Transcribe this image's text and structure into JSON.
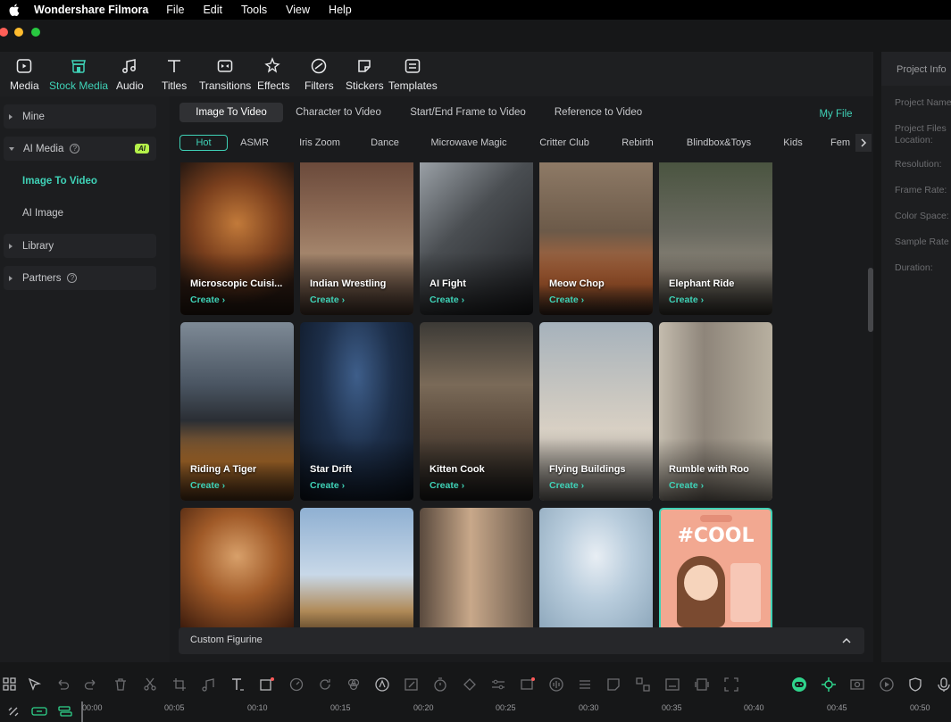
{
  "menubar": {
    "app_name": "Wondershare Filmora",
    "items": [
      "File",
      "Edit",
      "Tools",
      "View",
      "Help"
    ]
  },
  "window": {
    "traffic_colors": [
      "#ff5f57",
      "#febc2e",
      "#28c840"
    ]
  },
  "toolbar": {
    "accent": "#3fd2b7",
    "items": [
      {
        "label": "Media",
        "icon": "media-icon"
      },
      {
        "label": "Stock Media",
        "icon": "stock-media-icon",
        "active": true
      },
      {
        "label": "Audio",
        "icon": "audio-note-icon"
      },
      {
        "label": "Titles",
        "icon": "titles-t-icon"
      },
      {
        "label": "Transitions",
        "icon": "transitions-icon"
      },
      {
        "label": "Effects",
        "icon": "effects-icon"
      },
      {
        "label": "Filters",
        "icon": "filters-icon"
      },
      {
        "label": "Stickers",
        "icon": "stickers-icon"
      },
      {
        "label": "Templates",
        "icon": "templates-icon"
      }
    ]
  },
  "sidebar": {
    "mine": "Mine",
    "ai_media": "AI Media",
    "ai_badge": "AI",
    "image_to_video": "Image To Video",
    "ai_image": "AI Image",
    "library": "Library",
    "partners": "Partners"
  },
  "main": {
    "tabs": [
      "Image To Video",
      "Character to Video",
      "Start/End Frame to Video",
      "Reference to Video"
    ],
    "my_file": "My File",
    "chips": [
      "Hot",
      "ASMR",
      "Iris Zoom",
      "Dance",
      "Microwave Magic",
      "Critter Club",
      "Rebirth",
      "Blindbox&Toys",
      "Kids",
      "Fem"
    ],
    "create_label": "Create",
    "cards_row1": [
      "Microscopic Cuisi...",
      "Indian Wrestling",
      "AI Fight",
      "Meow Chop",
      "Elephant Ride"
    ],
    "cards_row2": [
      "Riding A Tiger",
      "Star Drift",
      "Kitten Cook",
      "Flying Buildings",
      "Rumble with Roo"
    ],
    "cool_text": "#COOL",
    "custom_bar_label": "Custom Figurine"
  },
  "right_panel": {
    "title": "Project Info",
    "labels": [
      "Project Name",
      "Project Files Location:",
      "Resolution:",
      "Frame Rate:",
      "Color Space:",
      "Sample Rate",
      "Duration:"
    ]
  },
  "timeline": {
    "ticks": [
      "00:00",
      "00:05",
      "00:10",
      "00:15",
      "00:20",
      "00:25",
      "00:30",
      "00:35",
      "00:40",
      "00:45",
      "00:50"
    ]
  }
}
